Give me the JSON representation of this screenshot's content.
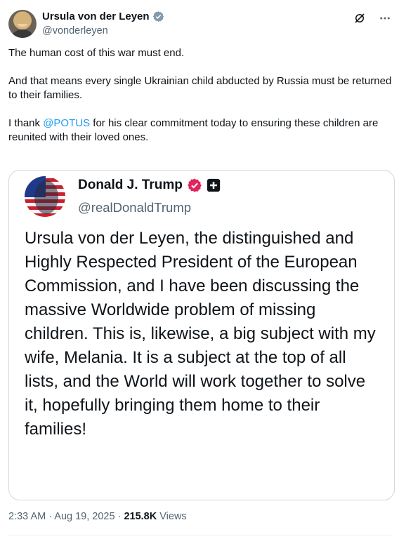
{
  "tweet": {
    "author_name": "Ursula von der Leyen",
    "author_handle": "@vonderleyen",
    "paragraph1": "The human cost of this war must end.",
    "paragraph2": "And that means every single Ukrainian child abducted by Russia must be returned to their families.",
    "paragraph3_prefix": "I thank ",
    "paragraph3_mention": "@POTUS",
    "paragraph3_suffix": " for his clear commitment today to ensuring these children are reunited with their loved ones.",
    "timestamp": "2:33 AM · Aug 19, 2025 · ",
    "views_count": "215.8K",
    "views_label": " Views"
  },
  "quoted": {
    "author_name": "Donald J. Trump",
    "author_handle": "@realDonaldTrump",
    "text": "Ursula von der Leyen, the distinguished and Highly Respected President of the European Commission, and I have been discussing the massive Worldwide problem of missing children. This is, likewise, a big subject with my wife, Melania. It is a subject at the top of all lists, and the World will work together to solve it, hopefully bringing them home to their families!"
  },
  "icons": {
    "verified": "verified-badge-icon",
    "grok": "grok-icon",
    "more": "more-icon",
    "truth_social": "truth-social-icon"
  },
  "colors": {
    "accent": "#1d9bf0",
    "badge_red": "#e0245e"
  }
}
